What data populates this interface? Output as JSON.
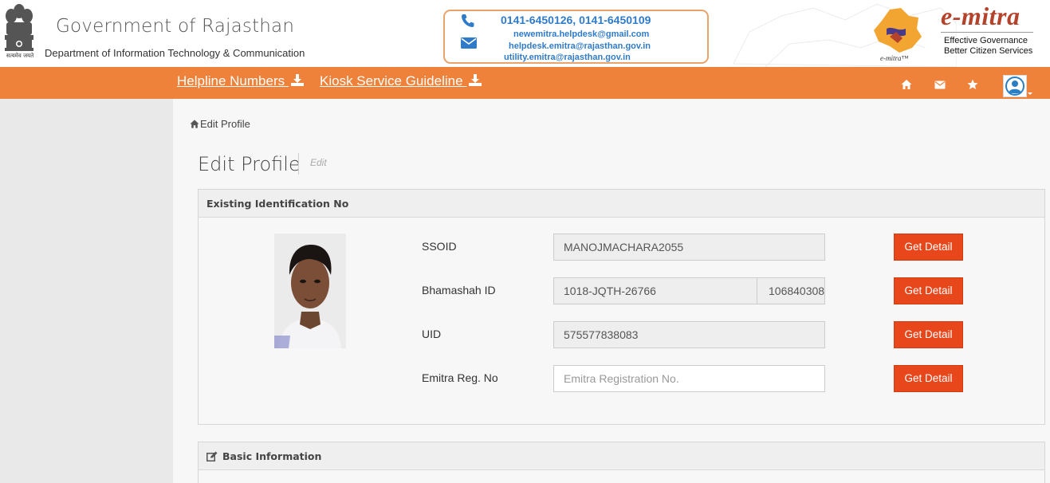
{
  "header": {
    "emblem_motto": "सत्यमेव जयते",
    "gov_title": "Government of Rajasthan",
    "dept_title": "Department of Information Technology & Communication",
    "contact": {
      "phones": "0141-6450126, 0141-6450109",
      "emails": [
        "newemitra.helpdesk@gmail.com",
        "helpdesk.emitra@rajasthan.gov.in",
        "utility.emitra@rajasthan.gov.in"
      ]
    },
    "logo_small_text": "e-mitra™",
    "brand": "e-mitra",
    "tagline_1": "Effective Governance",
    "tagline_2": "Better Citizen Services"
  },
  "nav": {
    "helpline_label": "Helpline Numbers",
    "kiosk_label": "Kiosk Service Guideline",
    "icons": [
      "home-icon",
      "envelope-icon",
      "star-icon",
      "user-avatar-icon"
    ]
  },
  "breadcrumb": {
    "label": "Edit Profile"
  },
  "page": {
    "title": "Edit Profile",
    "subtitle": "Edit"
  },
  "identification_panel": {
    "heading": "Existing Identification No",
    "fields": [
      {
        "label": "SSOID",
        "value": "MANOJMACHARA2055",
        "button": "Get Detail"
      },
      {
        "label": "Bhamashah ID",
        "value": "1018-JQTH-26766",
        "value2": "106840308",
        "button": "Get Detail"
      },
      {
        "label": "UID",
        "value": "575577838083",
        "button": "Get Detail"
      },
      {
        "label": "Emitra Reg. No",
        "value": "",
        "placeholder": "Emitra Registration No.",
        "button": "Get Detail"
      }
    ]
  },
  "basic_panel": {
    "heading": "Basic Information"
  },
  "colors": {
    "nav_orange": "#ee823a",
    "button_red": "#e7471b",
    "contact_blue": "#2f7bc9",
    "brand_red": "#b5432c"
  }
}
